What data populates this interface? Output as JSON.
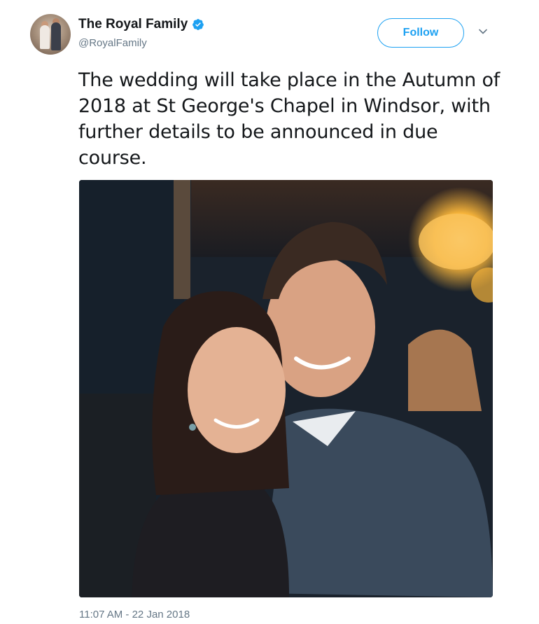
{
  "author": {
    "display_name": "The Royal Family",
    "handle": "@RoyalFamily",
    "verified": true,
    "avatar_icon": "couple-portrait-avatar"
  },
  "actions": {
    "follow_label": "Follow",
    "more_icon": "chevron-down-icon"
  },
  "tweet": {
    "text": "The wedding will take place in the Autumn of 2018 at St George's Chapel in Windsor, with further details to be announced in due course.",
    "timestamp": "11:07 AM - 22 Jan 2018"
  },
  "media": {
    "description_icon": "photo",
    "type": "photo"
  },
  "colors": {
    "accent": "#1da1f2",
    "text": "#14171a",
    "secondary_text": "#657786"
  }
}
